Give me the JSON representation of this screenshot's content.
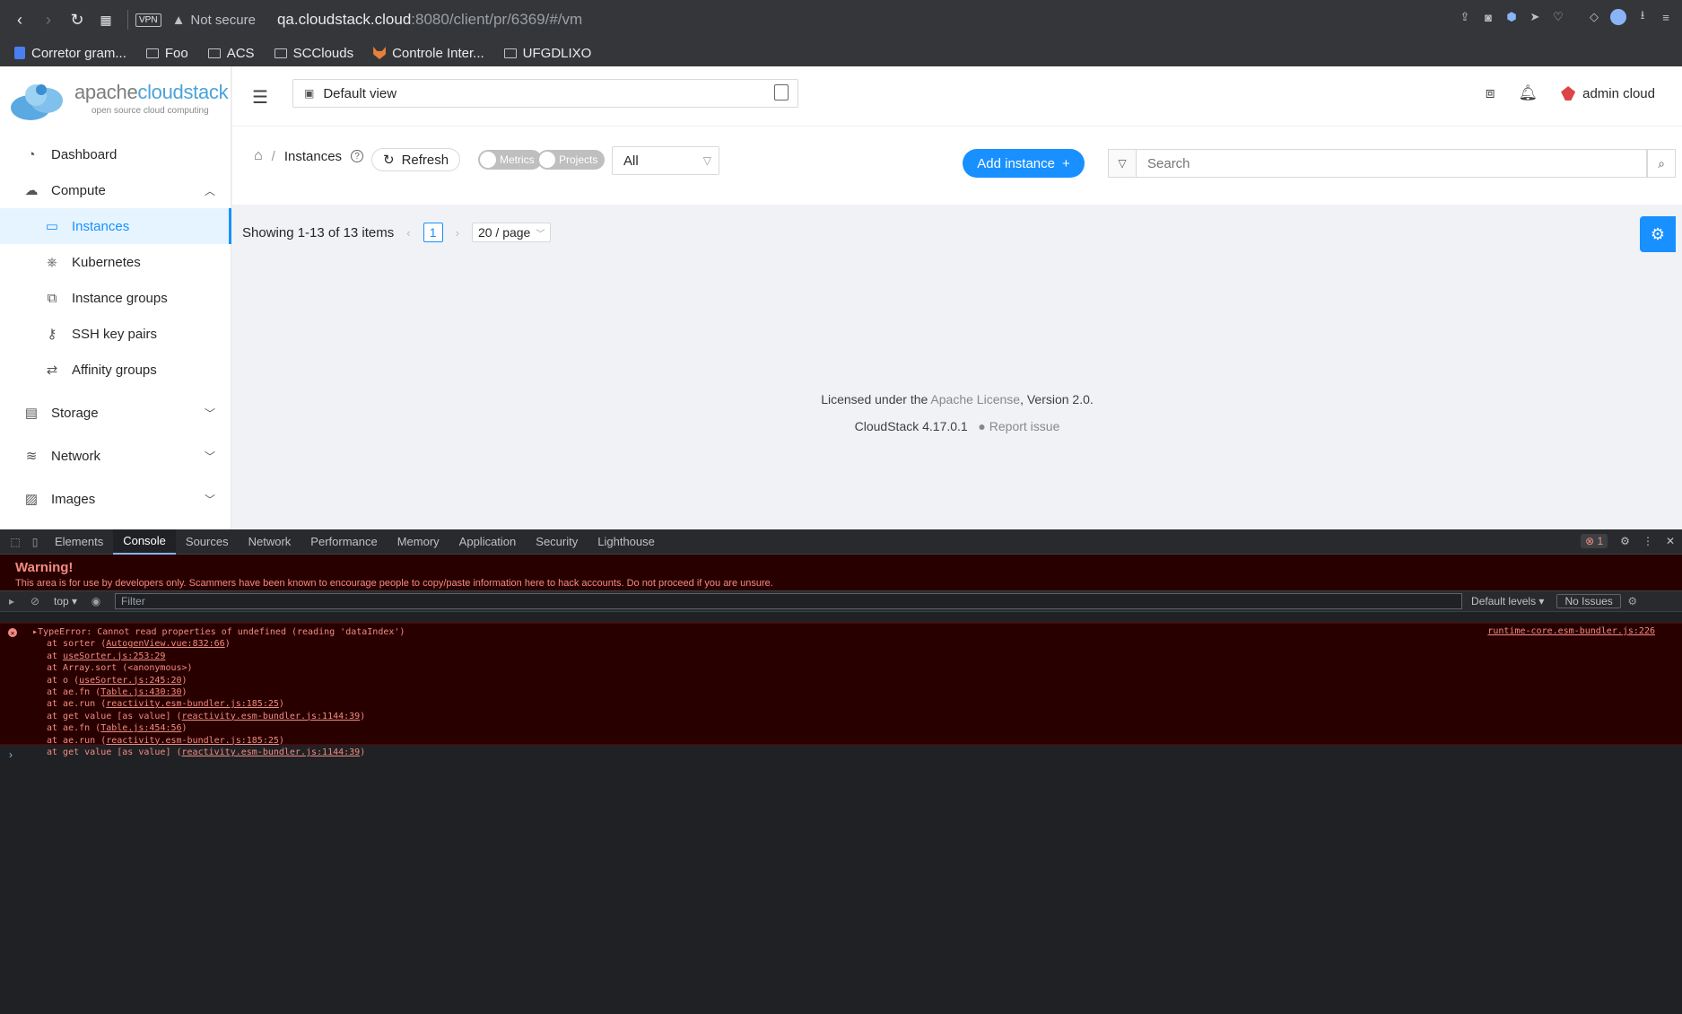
{
  "browser": {
    "not_secure": "Not secure",
    "url_host": "qa.cloudstack.cloud",
    "url_path": ":8080/client/pr/6369/#/vm",
    "vpn": "VPN",
    "bookmarks": [
      {
        "label": "Corretor gram...",
        "icon": "doc-icon"
      },
      {
        "label": "Foo",
        "icon": "folder-icon"
      },
      {
        "label": "ACS",
        "icon": "folder-icon"
      },
      {
        "label": "SCClouds",
        "icon": "folder-icon"
      },
      {
        "label": "Controle Inter...",
        "icon": "gitlab-icon"
      },
      {
        "label": "UFGDLIXO",
        "icon": "folder-icon"
      }
    ]
  },
  "logo": {
    "brand_a": "apache",
    "brand_b": "cloudstack",
    "tagline": "open source cloud computing"
  },
  "sidebar": {
    "items": [
      {
        "label": "Dashboard",
        "icon": "dashboard-icon"
      },
      {
        "label": "Compute",
        "icon": "cloud-icon",
        "expanded": true
      },
      {
        "label": "Instances",
        "icon": "desktop-icon",
        "active": true
      },
      {
        "label": "Kubernetes",
        "icon": "kubernetes-icon"
      },
      {
        "label": "Instance groups",
        "icon": "cluster-icon"
      },
      {
        "label": "SSH key pairs",
        "icon": "key-icon"
      },
      {
        "label": "Affinity groups",
        "icon": "swap-icon"
      },
      {
        "label": "Storage",
        "icon": "database-icon"
      },
      {
        "label": "Network",
        "icon": "wifi-icon"
      },
      {
        "label": "Images",
        "icon": "picture-icon"
      }
    ]
  },
  "header": {
    "view": "Default view",
    "user": "admin cloud"
  },
  "toolbar": {
    "breadcrumb": "Instances",
    "refresh": "Refresh",
    "metrics": "Metrics",
    "projects": "Projects",
    "filter": "All",
    "add_instance": "Add instance",
    "search_placeholder": "Search"
  },
  "pagination": {
    "summary": "Showing 1-13 of 13 items",
    "page": "1",
    "page_size": "20 / page"
  },
  "footer": {
    "license_prefix": "Licensed under the ",
    "license_link": "Apache License",
    "license_suffix": ", Version 2.0.",
    "version": "CloudStack 4.17.0.1",
    "report": "Report issue"
  },
  "devtools": {
    "tabs": [
      "Elements",
      "Console",
      "Sources",
      "Network",
      "Performance",
      "Memory",
      "Application",
      "Security",
      "Lighthouse"
    ],
    "active_tab": "Console",
    "error_count": "1",
    "warning_title": "Warning!",
    "warning_body": "This area is for use by developers only. Scammers have been known to encourage people to copy/paste information here to hack accounts. Do not proceed if you are unsure.",
    "context": "top",
    "filter_placeholder": "Filter",
    "levels": "Default levels",
    "issues": "No Issues",
    "error_source": "runtime-core.esm-bundler.js:226",
    "error_message": "TypeError: Cannot read properties of undefined (reading 'dataIndex')",
    "stack": [
      {
        "pre": "at sorter (",
        "link": "AutogenView.vue:832:66",
        "post": ")"
      },
      {
        "pre": "at ",
        "link": "useSorter.js:253:29",
        "post": ""
      },
      {
        "pre": "at Array.sort (<anonymous>)",
        "link": "",
        "post": ""
      },
      {
        "pre": "at o (",
        "link": "useSorter.js:245:20",
        "post": ")"
      },
      {
        "pre": "at ae.fn (",
        "link": "Table.js:430:30",
        "post": ")"
      },
      {
        "pre": "at ae.run (",
        "link": "reactivity.esm-bundler.js:185:25",
        "post": ")"
      },
      {
        "pre": "at get value [as value] (",
        "link": "reactivity.esm-bundler.js:1144:39",
        "post": ")"
      },
      {
        "pre": "at ae.fn (",
        "link": "Table.js:454:56",
        "post": ")"
      },
      {
        "pre": "at ae.run (",
        "link": "reactivity.esm-bundler.js:185:25",
        "post": ")"
      },
      {
        "pre": "at get value [as value] (",
        "link": "reactivity.esm-bundler.js:1144:39",
        "post": ")"
      }
    ]
  }
}
